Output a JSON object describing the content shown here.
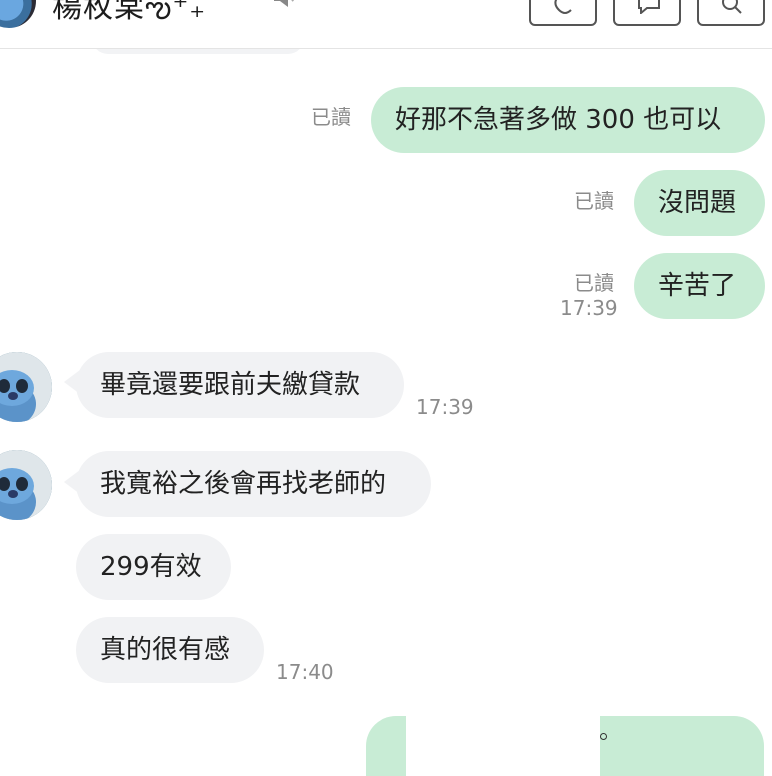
{
  "header": {
    "title": "楊枚棠ఌ⁺₊",
    "mute_icon": "speaker-muted-icon",
    "buttons": [
      "phone-icon",
      "chat-icon",
      "search-icon"
    ]
  },
  "colors": {
    "outgoing_bubble": "#c8ecd5",
    "incoming_bubble": "#f1f2f4",
    "meta_text": "#8b8b8b"
  },
  "messages": {
    "out1": {
      "read": "已讀",
      "text": "好那不急著多做 300 也可以"
    },
    "out2": {
      "read": "已讀",
      "text": "沒問題"
    },
    "out3": {
      "read": "已讀",
      "time": "17:39",
      "text": "辛苦了"
    },
    "in1": {
      "text": "畢竟還要跟前夫繳貸款",
      "time": "17:39"
    },
    "in2": {
      "text": "我寬裕之後會再找老師的"
    },
    "in3": {
      "text": "299有效"
    },
    "in4": {
      "text": "真的很有感",
      "time": "17:40"
    }
  }
}
